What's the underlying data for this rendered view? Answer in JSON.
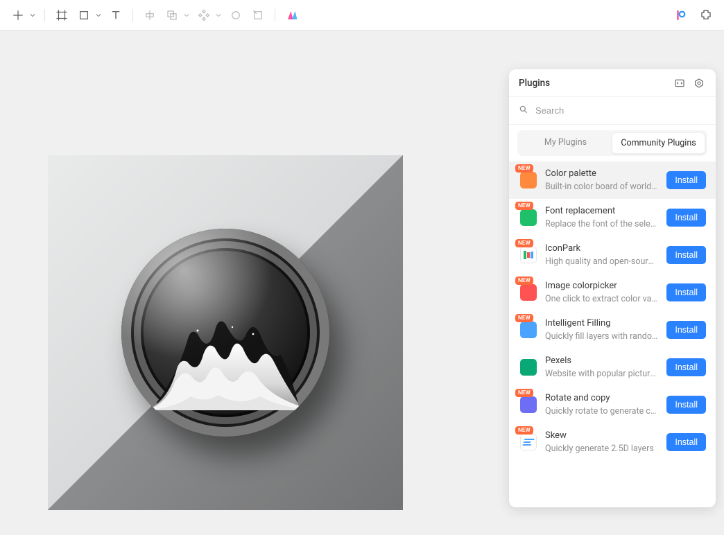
{
  "plugins_panel": {
    "title": "Plugins",
    "search_placeholder": "Search",
    "tabs": {
      "my": "My Plugins",
      "community": "Community Plugins"
    },
    "install_label": "Install",
    "new_badge": "NEW",
    "items": [
      {
        "name": "Color palette",
        "desc": "Built-in color board of world-r…",
        "icon": "ic-orange",
        "new": true,
        "highlight": true
      },
      {
        "name": "Font replacement",
        "desc": "Replace the font of the select…",
        "icon": "ic-green",
        "new": true,
        "highlight": false
      },
      {
        "name": "IconPark",
        "desc": "High quality and open-source i…",
        "icon": "ic-teal",
        "new": true,
        "highlight": false
      },
      {
        "name": "Image colorpicker",
        "desc": "One click to extract color valu…",
        "icon": "ic-red",
        "new": true,
        "highlight": false
      },
      {
        "name": "Intelligent Filling",
        "desc": "Quickly fill layers with random …",
        "icon": "ic-blue",
        "new": true,
        "highlight": false
      },
      {
        "name": "Pexels",
        "desc": "Website with popular pictures",
        "icon": "ic-dgreen",
        "new": false,
        "highlight": false
      },
      {
        "name": "Rotate and copy",
        "desc": "Quickly rotate to generate cop…",
        "icon": "ic-violet",
        "new": true,
        "highlight": false
      },
      {
        "name": "Skew",
        "desc": "Quickly generate 2.5D layers",
        "icon": "ic-sky",
        "new": true,
        "highlight": false
      }
    ]
  }
}
